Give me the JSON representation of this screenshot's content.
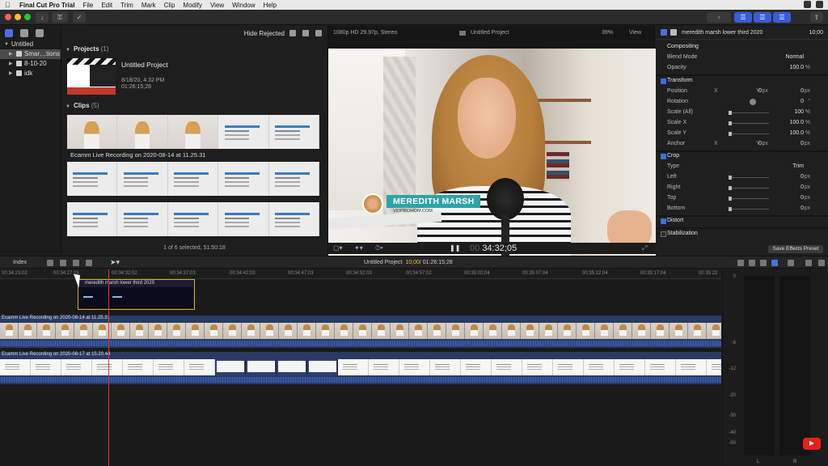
{
  "menubar": {
    "items": [
      "Final Cut Pro Trial",
      "File",
      "Edit",
      "Trim",
      "Mark",
      "Clip",
      "Modify",
      "View",
      "Window",
      "Help"
    ]
  },
  "libraries": {
    "items": [
      {
        "label": "Untitled"
      },
      {
        "label": "Smar…tions"
      },
      {
        "label": "8-10-20"
      },
      {
        "label": "idk"
      }
    ]
  },
  "browser": {
    "filter_label": "Hide Rejected",
    "projects_header": "Projects",
    "projects_count": "(1)",
    "project": {
      "title": "Untitled Project",
      "date": "8/18/20, 4:32 PM",
      "duration": "01:26:15;28"
    },
    "clips_header": "Clips",
    "clips_count": "(5)",
    "clip_label": "Ecamm Live Recording on 2020-08-14 at 11.25.31",
    "status": "1 of 6 selected, 51:50:18"
  },
  "viewer": {
    "format": "1080p HD 29.97p, Stereo",
    "project": "Untitled Project",
    "zoom": "39%",
    "view_label": "View",
    "lower_third_name": "MEREDITH MARSH",
    "lower_third_url": "VIDPROMOM.COM",
    "timecode_dim": "00",
    "timecode": "34:32;05"
  },
  "inspector": {
    "title": "meredith marsh lower third 2020",
    "duration": "10;00",
    "compositing": "Compositing",
    "blend_mode_label": "Blend Mode",
    "blend_mode_value": "Normal",
    "opacity_label": "Opacity",
    "opacity_value": "100.0",
    "transform": "Transform",
    "position_label": "Position",
    "position_x": "0",
    "position_y": "0",
    "rotation_label": "Rotation",
    "rotation_value": "0",
    "scale_all_label": "Scale (All)",
    "scale_all_value": "100",
    "scale_x_label": "Scale X",
    "scale_x_value": "100.0",
    "scale_y_label": "Scale Y",
    "scale_y_value": "100.0",
    "anchor_label": "Anchor",
    "anchor_x": "0",
    "anchor_y": "0",
    "crop": "Crop",
    "type_label": "Type",
    "type_value": "Trim",
    "left_label": "Left",
    "left_value": "0",
    "right_label": "Right",
    "right_value": "0",
    "top_label": "Top",
    "top_value": "0",
    "bottom_label": "Bottom",
    "bottom_value": "0",
    "distort": "Distort",
    "stabilization": "Stabilization",
    "save_preset": "Save Effects Preset",
    "unit_px": "px",
    "unit_pct": "%",
    "unit_deg": "°",
    "axis_x": "X",
    "axis_y": "Y"
  },
  "timeline_bar": {
    "index_label": "Index",
    "project": "Untitled Project",
    "position": "10;00",
    "total": "/ 01:26:15;28"
  },
  "timeline": {
    "ruler": [
      "00:34:23;02",
      "00:34:27;28",
      "00:34:32;02",
      "00:34:37;03",
      "00:34:42;03",
      "00:34:47;03",
      "00:34:52;03",
      "00:34:57;02",
      "00:35:02;04",
      "00:35:07;04",
      "00:35:12;04",
      "00:35:17;04",
      "00:35:22"
    ],
    "title_clip": "meredith marsh lower third 2020",
    "lane1": "Ecamm Live Recording on 2020-08-14 at 11.25.31",
    "lane2": "Ecamm Live Recording on 2020-08-17 at 15.20.44"
  },
  "meters": {
    "scale": [
      "0",
      "-6",
      "-12",
      "-20",
      "-30",
      "-40",
      "-50"
    ],
    "left": "L",
    "right": "R"
  }
}
